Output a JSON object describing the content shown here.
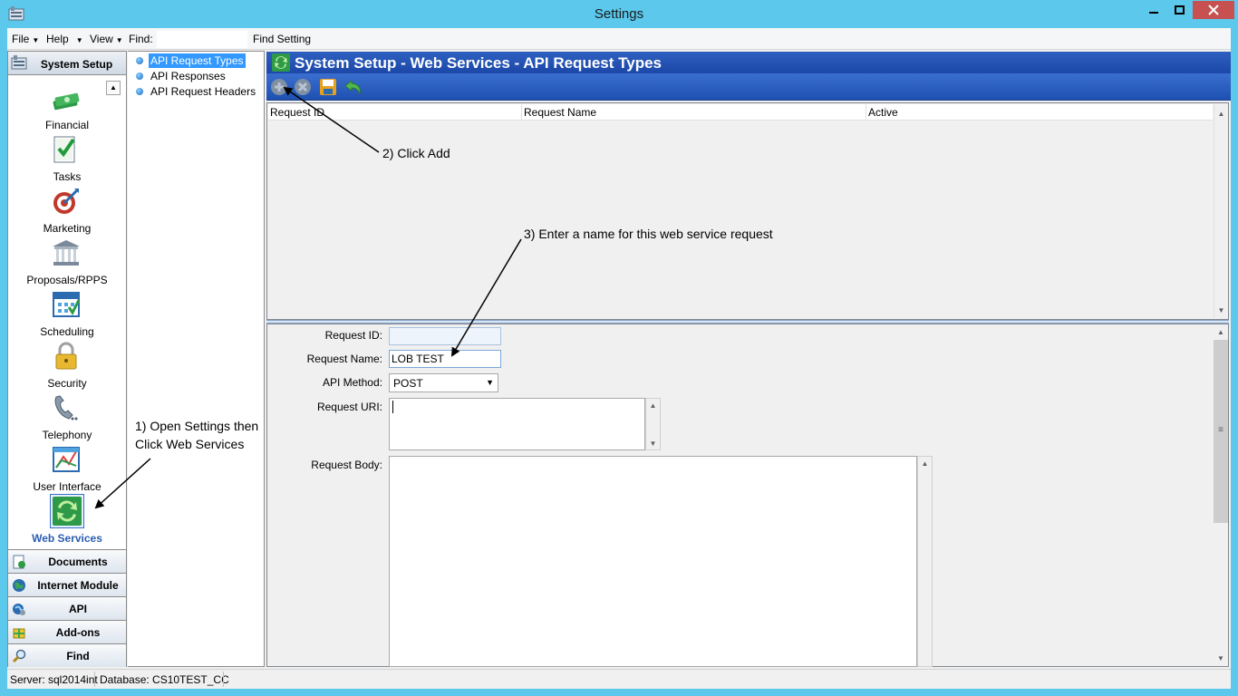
{
  "window": {
    "title": "Settings"
  },
  "menu": {
    "file": "File",
    "help": "Help",
    "view": "View",
    "find_label": "Find:",
    "find_setting": "Find Setting",
    "find_value": ""
  },
  "nav": {
    "header": "System Setup",
    "items": [
      {
        "label": "Financial",
        "icon": "money-icon"
      },
      {
        "label": "Tasks",
        "icon": "checklist-icon"
      },
      {
        "label": "Marketing",
        "icon": "target-icon"
      },
      {
        "label": "Proposals/RPPS",
        "icon": "building-icon"
      },
      {
        "label": "Scheduling",
        "icon": "calendar-icon"
      },
      {
        "label": "Security",
        "icon": "lock-icon"
      },
      {
        "label": "Telephony",
        "icon": "phone-icon"
      },
      {
        "label": "User Interface",
        "icon": "paint-icon"
      },
      {
        "label": "Web Services",
        "icon": "sync-icon",
        "active": true
      }
    ],
    "sections": [
      "Documents",
      "Internet Module",
      "API",
      "Add-ons",
      "Find"
    ]
  },
  "tree": {
    "items": [
      "API Request Types",
      "API Responses",
      "API Request Headers"
    ],
    "selected": "API Request Types"
  },
  "panel": {
    "title": "System Setup - Web Services - API Request Types",
    "toolbar": [
      "add-icon",
      "delete-icon",
      "save-icon",
      "undo-icon"
    ]
  },
  "grid": {
    "columns": [
      "Request ID",
      "Request Name",
      "Active"
    ],
    "rows": []
  },
  "form": {
    "request_id_label": "Request ID:",
    "request_id_value": "",
    "request_name_label": "Request Name:",
    "request_name_value": "LOB TEST",
    "api_method_label": "API Method:",
    "api_method_value": "POST",
    "request_uri_label": "Request URI:",
    "request_uri_value": "",
    "request_body_label": "Request Body:",
    "request_body_value": ""
  },
  "status": {
    "server": "Server: sql2014int",
    "database": "Database: CS10TEST_CC"
  },
  "annotations": {
    "step1_line1": "1) Open Settings then",
    "step1_line2": "Click Web Services",
    "step2": "2) Click Add",
    "step3": "3) Enter a name for this web service request"
  },
  "colors": {
    "titlebar": "#5bc8ec",
    "header_blue": "#1c48a8",
    "selection": "#3399ff",
    "close_button": "#c75050"
  }
}
